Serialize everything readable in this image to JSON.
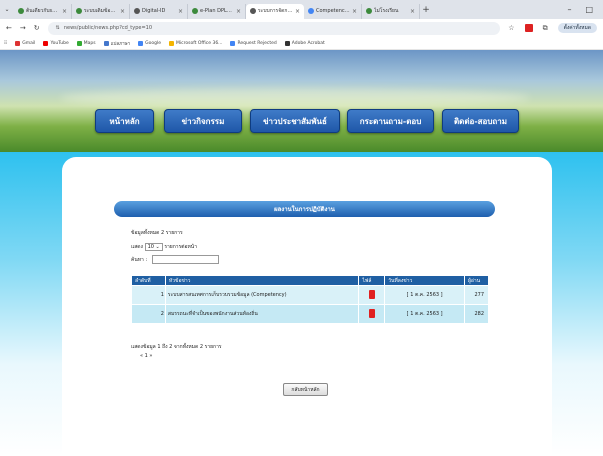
{
  "browser": {
    "tabs": [
      {
        "label": "ต้นเดียวกับsuna"
      },
      {
        "label": "ระบบเดิมข้อมูลร่วมส"
      },
      {
        "label": "Digital-ID"
      },
      {
        "label": "e-Plan DPLAN66-H"
      },
      {
        "label": "ระบบการจัดการเว็บไซ",
        "active": true
      },
      {
        "label": "Competency สรรถน"
      },
      {
        "label": "ไม่โรงเรียน"
      }
    ],
    "url": "news/public/news.php?cd_type=10",
    "profile": "ตั้งค่าทั้งหมด",
    "bookmarks": [
      "Gmail",
      "YouTube",
      "Maps",
      "แปลภาษา",
      "Google",
      "Microsoft Office 36...",
      "Request Rejected",
      "Adobe Acrobat"
    ]
  },
  "nav": {
    "home": "หน้าหลัก",
    "activities": "ข่าวกิจกรรม",
    "pr": "ข่าวประชาสัมพันธ์",
    "board": "กระดานถาม-ตอบ",
    "contact": "ติดต่อ-สอบถาม"
  },
  "section_title": "ผลงานในการปฏิบัติงาน",
  "total_label": "ข้อมูลทั้งหมด 2 รายการ",
  "show_prefix": "แสดง",
  "per_page": "10",
  "per_page_suffix": "รายการต่อหน้า",
  "search_label": "ค้นหา :",
  "table": {
    "headers": [
      "ลำดับที่",
      "หัวข้อข่าว",
      "ไฟล์",
      "วันที่ลงข่าว",
      "ผู้อ่าน"
    ],
    "rows": [
      {
        "no": "1",
        "title": "ระบบสารสนเทศการเก็บรวบรวมข้อมูล (Competency)",
        "date": "[ 1 ต.ค. 2563 ]",
        "reads": "277"
      },
      {
        "no": "2",
        "title": "สมรรถนะที่จำเป็นของพนักงานส่วนท้องถิ่น",
        "date": "[ 1 ต.ค. 2563 ]",
        "reads": "282"
      }
    ]
  },
  "summary": "แสดงข้อมูล 1 ถึง 2 จากทั้งหมด 2 รายการ",
  "pagination": "« 1 »",
  "home_button": "กลับหน้าหลัก"
}
